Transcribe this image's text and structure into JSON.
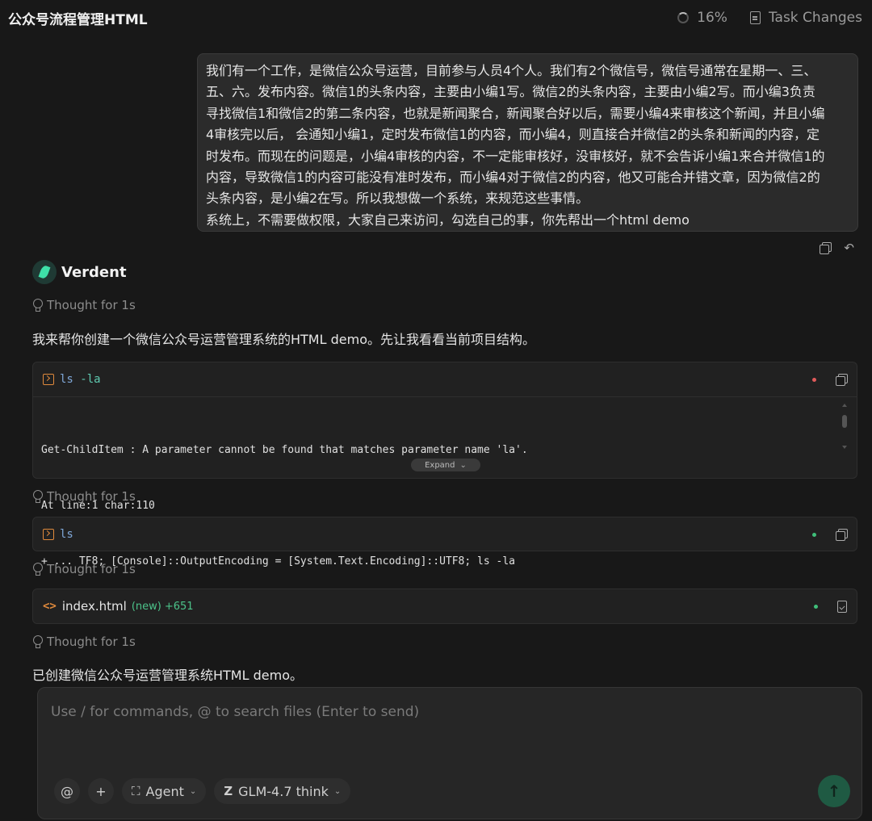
{
  "header": {
    "title": "公众号流程管理HTML",
    "progress": "16%",
    "task_changes_label": "Task Changes"
  },
  "user_message": {
    "lines": [
      "我们有一个工作，是微信公众号运营，目前参与人员4个人。我们有2个微信号，微信号通常在星期一、三、",
      "五、六。发布内容。微信1的头条内容，主要由小编1写。微信2的头条内容，主要由小编2写。而小编3负责",
      "寻找微信1和微信2的第二条内容，也就是新闻聚合，新闻聚合好以后，需要小编4来审核这个新闻，并且小编",
      "4审核完以后， 会通知小编1，定时发布微信1的内容，而小编4，则直接合并微信2的头条和新闻的内容，定",
      "时发布。而现在的问题是，小编4审核的内容，不一定能审核好，没审核好，就不会告诉小编1来合并微信1的",
      "内容，导致微信1的内容可能没有准时发布，而小编4对于微信2的内容，他又可能合并错文章，因为微信2的",
      "头条内容，是小编2在写。所以我想做一个系统，来规范这些事情。",
      "系统上，不需要做权限，大家自己来访问，勾选自己的事，你先帮出一个html demo"
    ]
  },
  "agent": {
    "name": "Verdent",
    "thoughts": [
      "Thought for 1s",
      "Thought for 1s",
      "Thought for 1s",
      "Thought for 1s"
    ],
    "intro_text": "我来帮你创建一个微信公众号运营管理系统的HTML demo。先让我看看当前项目结构。",
    "final_text": "已创建微信公众号运营管理系统HTML demo。"
  },
  "tools": {
    "cmd1": {
      "name": "ls",
      "flag": " -la",
      "status": "error",
      "output": [
        "Get-ChildItem : A parameter cannot be found that matches parameter name 'la'.",
        "At line:1 char:110",
        "+ ... TF8; [Console]::OutputEncoding = [System.Text.Encoding]::UTF8; ls -la"
      ],
      "expand_label": "Expand"
    },
    "cmd2": {
      "name": "ls",
      "status": "success"
    },
    "file": {
      "name": "index.html",
      "tag": "(new)",
      "added": "+651",
      "status": "success"
    }
  },
  "composer": {
    "placeholder": "Use / for commands, @ to search files (Enter to send)",
    "at_label": "@",
    "plus_label": "+",
    "mode_label": "Agent",
    "model_label": "GLM-4.7 think"
  },
  "colors": {
    "accent_green": "#3fbf7a",
    "error_red": "#e05a5a",
    "terminal_orange": "#e08a3c"
  }
}
